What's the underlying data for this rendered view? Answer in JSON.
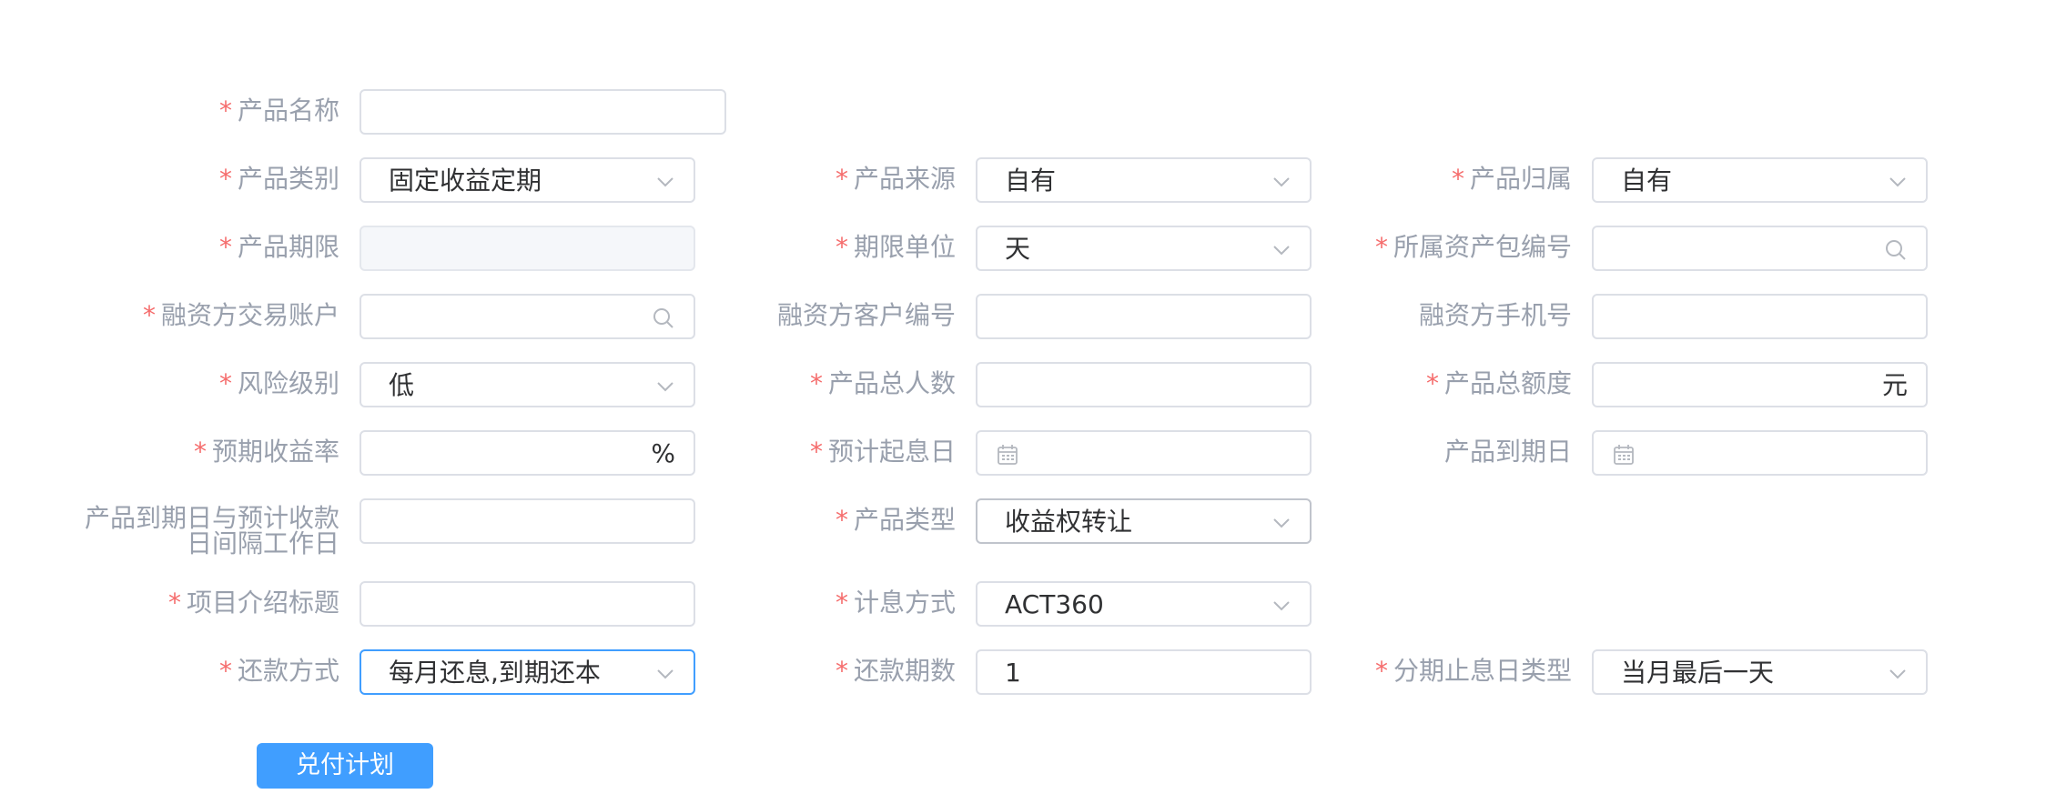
{
  "rows": {
    "product_name": {
      "label": "产品名称"
    },
    "product_category": {
      "label": "产品类别",
      "value": "固定收益定期"
    },
    "product_source": {
      "label": "产品来源",
      "value": "自有"
    },
    "product_owner": {
      "label": "产品归属",
      "value": "自有"
    },
    "product_term": {
      "label": "产品期限"
    },
    "term_unit": {
      "label": "期限单位",
      "value": "天"
    },
    "asset_package_no": {
      "label": "所属资产包编号"
    },
    "financier_account": {
      "label": "融资方交易账户"
    },
    "financier_customer_no": {
      "label": "融资方客户编号"
    },
    "financier_phone": {
      "label": "融资方手机号"
    },
    "risk_level": {
      "label": "风险级别",
      "value": "低"
    },
    "total_people": {
      "label": "产品总人数"
    },
    "total_amount": {
      "label": "产品总额度",
      "suffix": "元"
    },
    "expected_rate": {
      "label": "预期收益率",
      "suffix": "%"
    },
    "value_date": {
      "label": "预计起息日"
    },
    "maturity_date": {
      "label": "产品到期日"
    },
    "interval_days": {
      "label_line1": "产品到期日与预计收款",
      "label_line2": "日间隔工作日"
    },
    "product_type": {
      "label": "产品类型",
      "value": "收益权转让"
    },
    "project_title": {
      "label": "项目介绍标题"
    },
    "interest_method": {
      "label": "计息方式",
      "value": "ACT360"
    },
    "repay_method": {
      "label": "还款方式",
      "value": "每月还息,到期还本"
    },
    "repay_periods": {
      "label": "还款期数",
      "value": "1"
    },
    "installment_stop_type": {
      "label": "分期止息日类型",
      "value": "当月最后一天"
    }
  },
  "required_mark": "*",
  "icons": {
    "select": "chevron-down-icon",
    "search": "search-icon",
    "date": "calendar-icon"
  },
  "colors": {
    "primary": "#409eff",
    "required": "#f56c6c",
    "label": "#99a0ad",
    "border": "#dcdfe6"
  },
  "actions": {
    "payment_plan_label": "兑付计划"
  }
}
